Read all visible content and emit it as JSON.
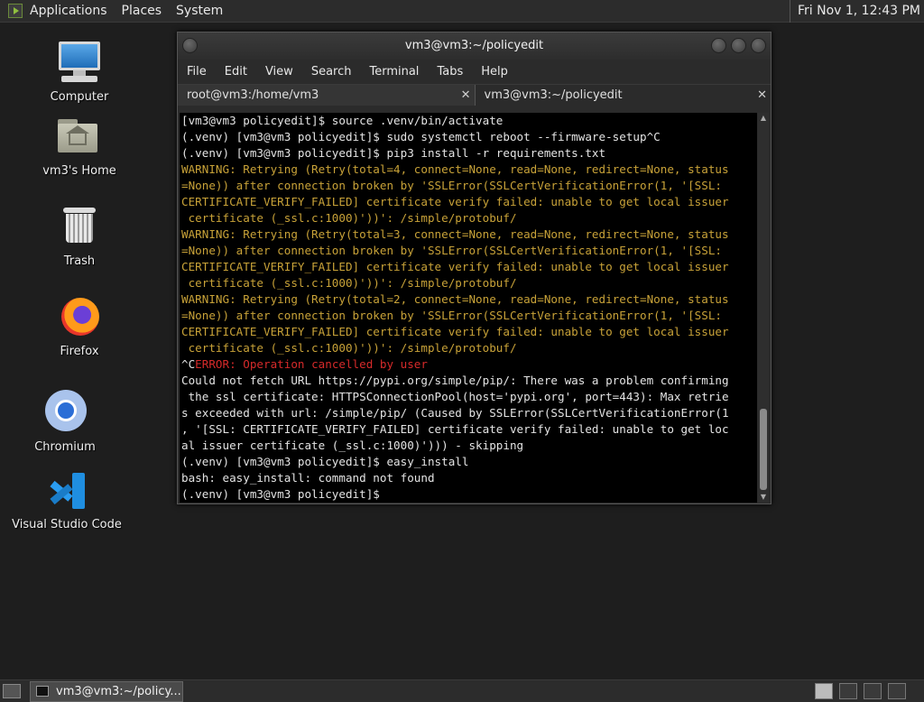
{
  "top_panel": {
    "menus": [
      "Applications",
      "Places",
      "System"
    ],
    "clock": "Fri Nov  1, 12:43 PM"
  },
  "desktop": {
    "icons": [
      {
        "label": "Computer",
        "icon": "computer-icon"
      },
      {
        "label": "vm3's Home",
        "icon": "home-folder-icon"
      },
      {
        "label": "Trash",
        "icon": "trash-icon"
      },
      {
        "label": "Firefox",
        "icon": "firefox-icon"
      },
      {
        "label": "Chromium",
        "icon": "chromium-icon"
      },
      {
        "label": "Visual Studio Code",
        "icon": "vscode-icon"
      }
    ]
  },
  "terminal_window": {
    "title": "vm3@vm3:~/policyedit",
    "menu": [
      "File",
      "Edit",
      "View",
      "Search",
      "Terminal",
      "Tabs",
      "Help"
    ],
    "tabs": [
      {
        "label": "root@vm3:/home/vm3",
        "active": false
      },
      {
        "label": "vm3@vm3:~/policyedit",
        "active": true
      }
    ],
    "close_glyph": "✕",
    "lines": [
      {
        "text": "[vm3@vm3 policyedit]$ source .venv/bin/activate",
        "kind": "normal"
      },
      {
        "text": "(.venv) [vm3@vm3 policyedit]$ sudo systemctl reboot --firmware-setup^C",
        "kind": "normal"
      },
      {
        "text": "(.venv) [vm3@vm3 policyedit]$ pip3 install -r requirements.txt",
        "kind": "normal"
      },
      {
        "text": "WARNING: Retrying (Retry(total=4, connect=None, read=None, redirect=None, status",
        "kind": "warn"
      },
      {
        "text": "=None)) after connection broken by 'SSLError(SSLCertVerificationError(1, '[SSL:",
        "kind": "warn"
      },
      {
        "text": "CERTIFICATE_VERIFY_FAILED] certificate verify failed: unable to get local issuer",
        "kind": "warn"
      },
      {
        "text": " certificate (_ssl.c:1000)'))': /simple/protobuf/",
        "kind": "warn"
      },
      {
        "text": "WARNING: Retrying (Retry(total=3, connect=None, read=None, redirect=None, status",
        "kind": "warn"
      },
      {
        "text": "=None)) after connection broken by 'SSLError(SSLCertVerificationError(1, '[SSL:",
        "kind": "warn"
      },
      {
        "text": "CERTIFICATE_VERIFY_FAILED] certificate verify failed: unable to get local issuer",
        "kind": "warn"
      },
      {
        "text": " certificate (_ssl.c:1000)'))': /simple/protobuf/",
        "kind": "warn"
      },
      {
        "text": "WARNING: Retrying (Retry(total=2, connect=None, read=None, redirect=None, status",
        "kind": "warn"
      },
      {
        "text": "=None)) after connection broken by 'SSLError(SSLCertVerificationError(1, '[SSL:",
        "kind": "warn"
      },
      {
        "text": "CERTIFICATE_VERIFY_FAILED] certificate verify failed: unable to get local issuer",
        "kind": "warn"
      },
      {
        "text": " certificate (_ssl.c:1000)'))': /simple/protobuf/",
        "kind": "warn"
      },
      {
        "segments": [
          {
            "text": "^C",
            "kind": "normal"
          },
          {
            "text": "ERROR: Operation cancelled by user",
            "kind": "err"
          }
        ]
      },
      {
        "text": "Could not fetch URL https://pypi.org/simple/pip/: There was a problem confirming",
        "kind": "normal"
      },
      {
        "text": " the ssl certificate: HTTPSConnectionPool(host='pypi.org', port=443): Max retrie",
        "kind": "normal"
      },
      {
        "text": "s exceeded with url: /simple/pip/ (Caused by SSLError(SSLCertVerificationError(1",
        "kind": "normal"
      },
      {
        "text": ", '[SSL: CERTIFICATE_VERIFY_FAILED] certificate verify failed: unable to get loc",
        "kind": "normal"
      },
      {
        "text": "al issuer certificate (_ssl.c:1000)'))) - skipping",
        "kind": "normal"
      },
      {
        "text": "(.venv) [vm3@vm3 policyedit]$ easy_install",
        "kind": "normal"
      },
      {
        "text": "bash: easy_install: command not found",
        "kind": "normal"
      },
      {
        "text": "(.venv) [vm3@vm3 policyedit]$ ",
        "kind": "normal"
      }
    ]
  },
  "taskbar": {
    "window_button": "vm3@vm3:~/policy...",
    "workspace_count": 4,
    "current_workspace": 1
  },
  "colors": {
    "warn": "#c8a238",
    "error": "#d62a2a",
    "terminal_bg": "#000000"
  }
}
